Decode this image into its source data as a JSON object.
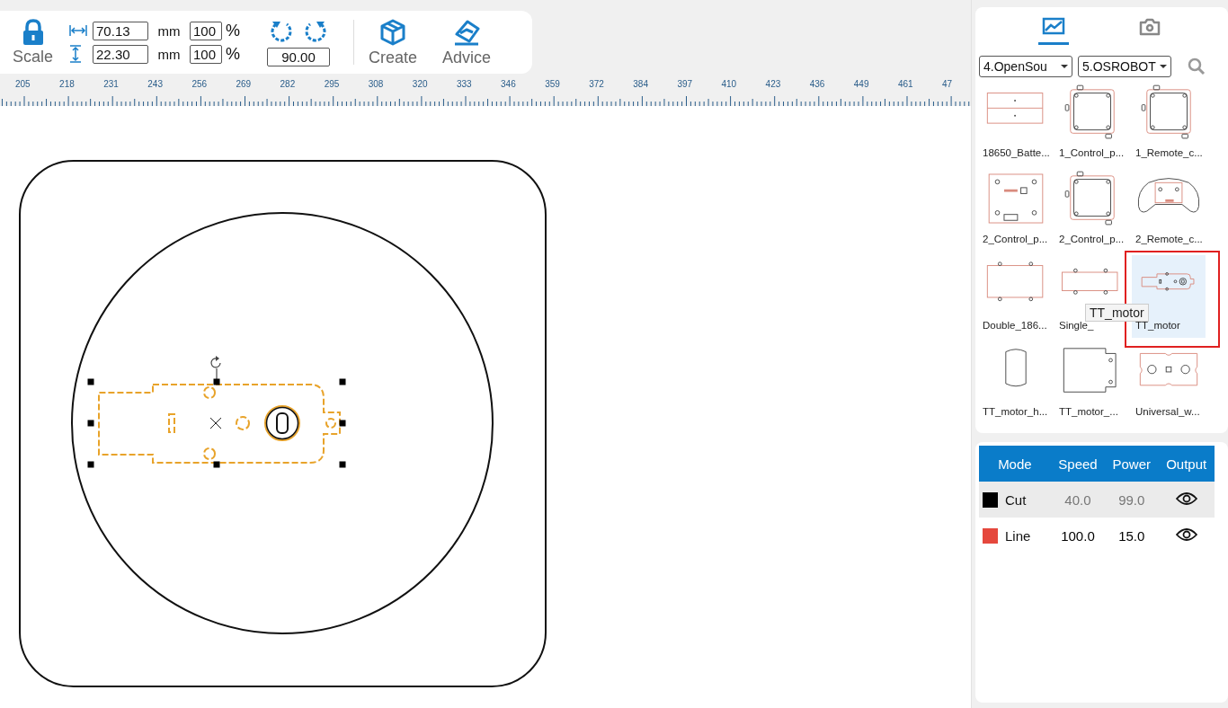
{
  "toolbar": {
    "scale_label": "Scale",
    "width": {
      "value": "70.13",
      "unit": "mm",
      "percent": "100",
      "percent_sign": "%"
    },
    "height": {
      "value": "22.30",
      "unit": "mm",
      "percent": "100",
      "percent_sign": "%"
    },
    "angle": "90.00",
    "buttons": [
      {
        "kind": "create",
        "label": "Create"
      },
      {
        "kind": "advice",
        "label": "Advice"
      }
    ]
  },
  "ruler": {
    "labels": [
      "205",
      "218",
      "231",
      "243",
      "256",
      "269",
      "282",
      "295",
      "308",
      "320",
      "333",
      "346",
      "359",
      "372",
      "384",
      "397",
      "410",
      "423",
      "436",
      "449",
      "461",
      "47"
    ]
  },
  "library": {
    "tabs": [
      {
        "kind": "image",
        "selected": true
      },
      {
        "kind": "camera",
        "selected": false
      }
    ],
    "dropdowns": [
      "4.OpenSou",
      "5.OSROBOT"
    ],
    "items": [
      {
        "label": "18650_Batte...",
        "kind": "holder",
        "selected": false
      },
      {
        "label": "1_Control_p...",
        "kind": "board",
        "selected": false
      },
      {
        "label": "1_Remote_c...",
        "kind": "board",
        "selected": false
      },
      {
        "label": "2_Control_p...",
        "kind": "plate",
        "selected": false
      },
      {
        "label": "2_Control_p...",
        "kind": "board",
        "selected": false
      },
      {
        "label": "2_Remote_c...",
        "kind": "controller",
        "selected": false
      },
      {
        "label": "Double_186...",
        "kind": "rect",
        "selected": false
      },
      {
        "label": "Single_",
        "kind": "strip",
        "selected": false
      },
      {
        "label": "TT_motor",
        "kind": "motor",
        "selected": true
      },
      {
        "label": "TT_motor_h...",
        "kind": "round",
        "selected": false
      },
      {
        "label": "TT_motor_...",
        "kind": "bracket",
        "selected": false
      },
      {
        "label": "Universal_w...",
        "kind": "wheel",
        "selected": false
      }
    ],
    "tooltip": "TT_motor"
  },
  "layers": {
    "columns": [
      "Mode",
      "Speed",
      "Power",
      "Output"
    ],
    "rows": [
      {
        "color": "#000000",
        "mode": "Cut",
        "speed": "40.0",
        "power": "99.0",
        "visible": true,
        "selected": true
      },
      {
        "color": "#e5483d",
        "mode": "Line",
        "speed": "100.0",
        "power": "15.0",
        "visible": true,
        "selected": false
      }
    ]
  }
}
